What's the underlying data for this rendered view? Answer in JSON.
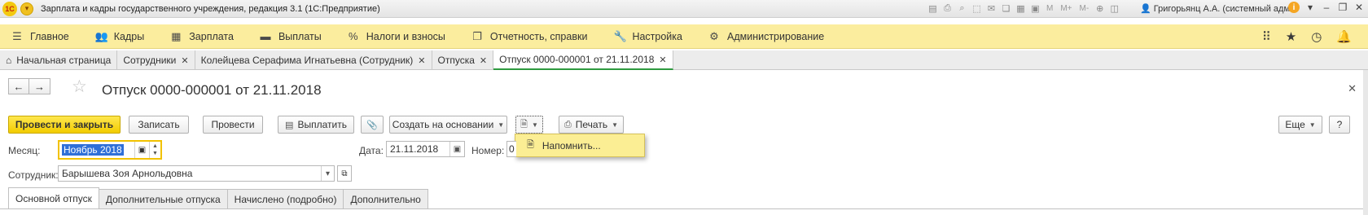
{
  "app": {
    "logo_text": "1С",
    "title": "Зарплата и кадры государственного учреждения, редакция 3.1  (1С:Предприятие)",
    "toolbar_m_labels": [
      "M",
      "M+",
      "M-"
    ],
    "user": "Григорьянц А.А. (системный адм...",
    "window_buttons": [
      "–",
      "❐",
      "✕"
    ]
  },
  "sections": [
    {
      "label": "Главное",
      "icon": "menu-icon"
    },
    {
      "label": "Кадры",
      "icon": "people-icon"
    },
    {
      "label": "Зарплата",
      "icon": "calculator-icon"
    },
    {
      "label": "Выплаты",
      "icon": "wallet-icon"
    },
    {
      "label": "Налоги и взносы",
      "icon": "percent-icon"
    },
    {
      "label": "Отчетность, справки",
      "icon": "reports-icon"
    },
    {
      "label": "Настройка",
      "icon": "wrench-icon"
    },
    {
      "label": "Администрирование",
      "icon": "gear-icon"
    }
  ],
  "tabs": [
    {
      "label": "Начальная страница",
      "home": true
    },
    {
      "label": "Сотрудники"
    },
    {
      "label": "Колейцева Серафима Игнатьевна (Сотрудник)"
    },
    {
      "label": "Отпуска"
    },
    {
      "label": "Отпуск 0000-000001 от 21.11.2018",
      "active": true
    }
  ],
  "document": {
    "title": "Отпуск 0000-000001 от 21.11.2018"
  },
  "commands": {
    "post_close": "Провести и закрыть",
    "save": "Записать",
    "post": "Провести",
    "pay": "Выплатить",
    "create_based": "Создать на основании",
    "print": "Печать",
    "more": "Еще",
    "help": "?"
  },
  "popup": {
    "remind": "Напомнить..."
  },
  "fields": {
    "month_label": "Месяц:",
    "month_value": "Ноябрь 2018",
    "date_label": "Дата:",
    "date_value": "21.11.2018",
    "number_label": "Номер:",
    "number_value": "0",
    "employee_label": "Сотрудник:",
    "employee_value": "Барышева Зоя Арнольдовна"
  },
  "page_tabs": [
    {
      "label": "Основной отпуск",
      "active": true
    },
    {
      "label": "Дополнительные отпуска"
    },
    {
      "label": "Начислено (подробно)"
    },
    {
      "label": "Дополнительно"
    }
  ],
  "colors": {
    "section_bar": "#fbed9e",
    "primary_button": "#f2cc00",
    "active_tab_underline": "#2e9a3f",
    "selection": "#2f6fd8"
  }
}
